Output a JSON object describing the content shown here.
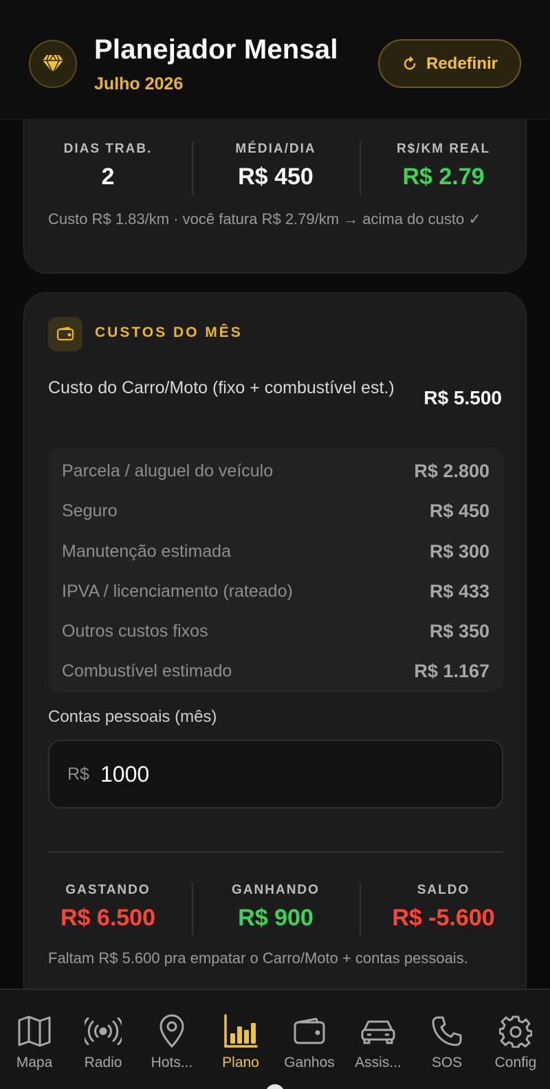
{
  "header": {
    "title": "Planejador Mensal",
    "subtitle": "Julho 2026",
    "reset_label": "Redefinir",
    "logo_icon": "diamond-icon"
  },
  "summary_top": {
    "stats": [
      {
        "label": "DIAS TRAB.",
        "value": "2"
      },
      {
        "label": "MÉDIA/DIA",
        "value": "R$ 450"
      },
      {
        "label": "R$/KM REAL",
        "value": "R$ 2.79"
      }
    ],
    "note": "Custo R$ 1.83/km · você fatura R$ 2.79/km → acima do custo ✓"
  },
  "costs": {
    "section_title": "CUSTOS DO MÊS",
    "section_icon": "wallet-icon",
    "car_label": "Custo do Carro/Moto (fixo + combustível est.)",
    "car_total": "R$ 5.500",
    "breakdown": [
      {
        "label": "Parcela / aluguel do veículo",
        "value": "R$ 2.800"
      },
      {
        "label": "Seguro",
        "value": "R$ 450"
      },
      {
        "label": "Manutenção estimada",
        "value": "R$ 300"
      },
      {
        "label": "IPVA / licenciamento (rateado)",
        "value": "R$ 433"
      },
      {
        "label": "Outros custos fixos",
        "value": "R$ 350"
      },
      {
        "label": "Combustível estimado",
        "value": "R$ 1.167"
      }
    ],
    "personal_label": "Contas pessoais (mês)",
    "personal_currency": "R$",
    "personal_value": "1000",
    "summary": [
      {
        "label": "GASTANDO",
        "value": "R$ 6.500"
      },
      {
        "label": "GANHANDO",
        "value": "R$ 900"
      },
      {
        "label": "SALDO",
        "value": "R$ -5.600"
      }
    ],
    "summary_note": "Faltam R$ 5.600 pra empatar o Carro/Moto + contas pessoais."
  },
  "colors": {
    "accent": "#e9b52d",
    "positive": "#3fd15a",
    "negative": "#ff4538"
  },
  "nav": {
    "items": [
      {
        "label": "Mapa",
        "icon": "map-icon"
      },
      {
        "label": "Radio",
        "icon": "radio-icon"
      },
      {
        "label": "Hots...",
        "icon": "location-pin-icon"
      },
      {
        "label": "Plano",
        "icon": "bar-chart-icon",
        "active": true
      },
      {
        "label": "Ganhos",
        "icon": "wallet-icon"
      },
      {
        "label": "Assis...",
        "icon": "car-icon"
      },
      {
        "label": "SOS",
        "icon": "phone-icon"
      },
      {
        "label": "Config",
        "icon": "gear-icon"
      }
    ]
  }
}
